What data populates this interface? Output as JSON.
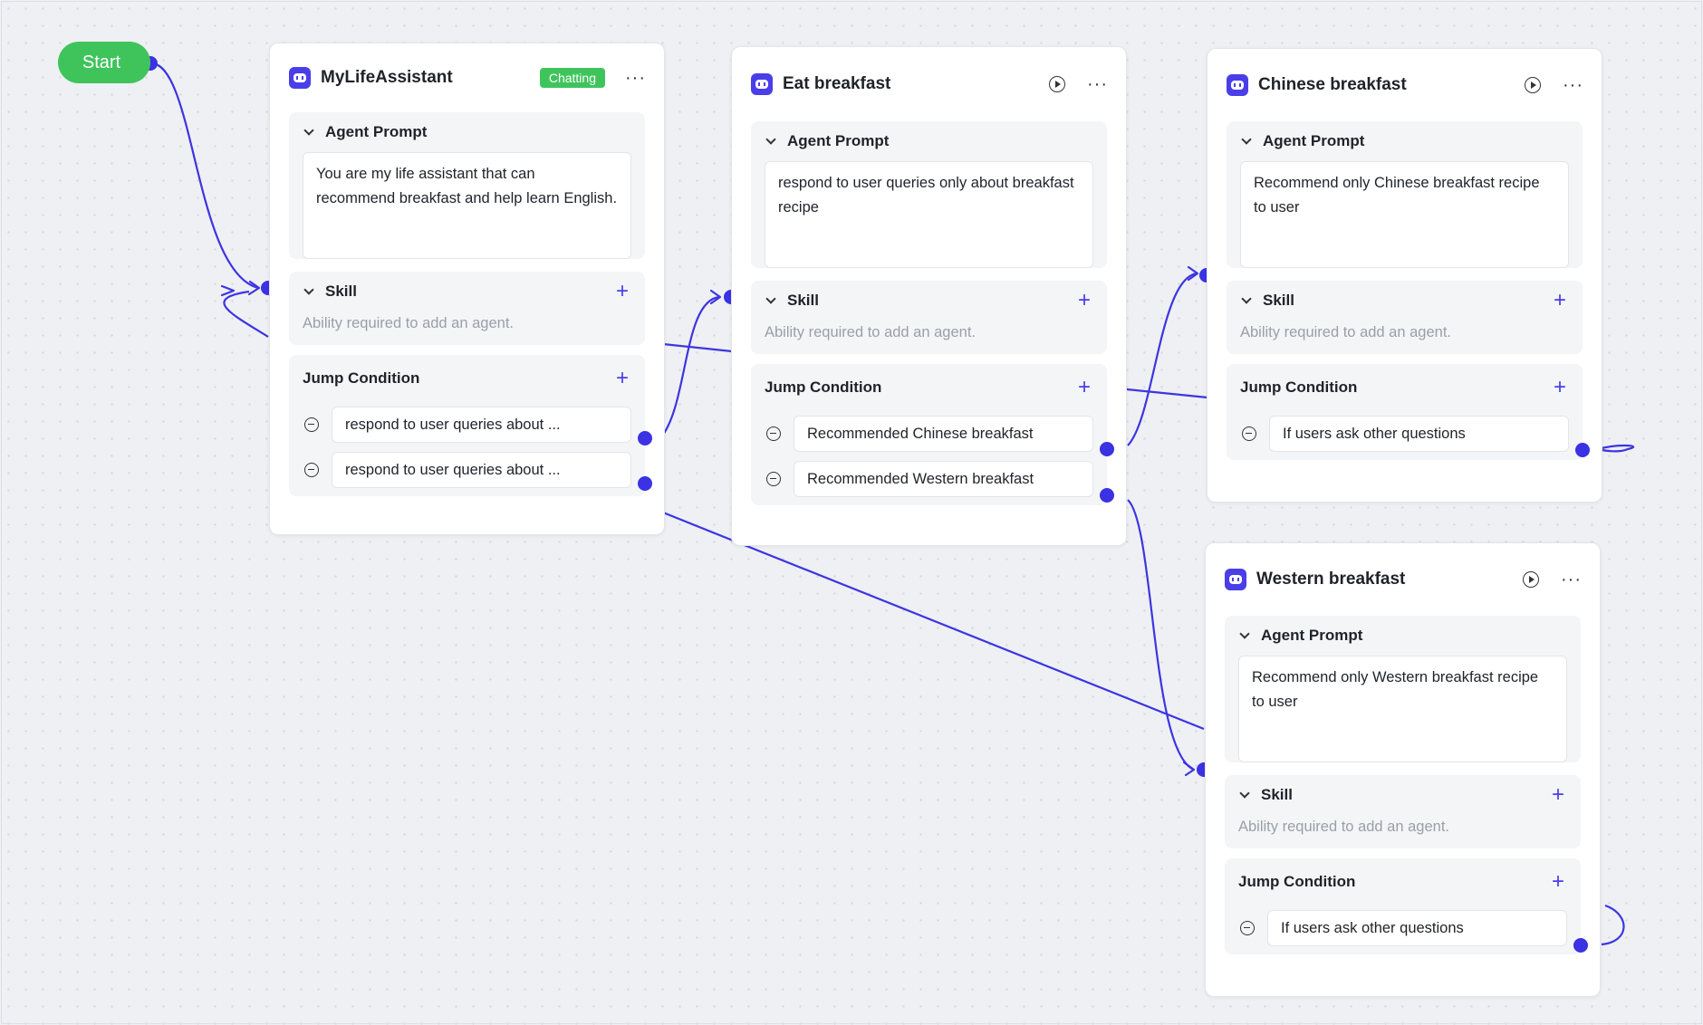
{
  "start": {
    "label": "Start"
  },
  "nodes": [
    {
      "title": "MyLifeAssistant",
      "badge": "Chatting",
      "prompt_label": "Agent Prompt",
      "prompt": "You are my life assistant that can recommend breakfast and help learn English.",
      "skill_label": "Skill",
      "skill_hint": "Ability required to add an agent.",
      "jump_label": "Jump Condition",
      "conditions": [
        "respond to user queries about ...",
        "respond to user queries about ..."
      ]
    },
    {
      "title": "Eat breakfast",
      "prompt_label": "Agent Prompt",
      "prompt": "respond to user queries only about breakfast recipe",
      "skill_label": "Skill",
      "skill_hint": "Ability required to add an agent.",
      "jump_label": "Jump Condition",
      "conditions": [
        "Recommended Chinese breakfast",
        "Recommended Western breakfast"
      ]
    },
    {
      "title": "Chinese breakfast",
      "prompt_label": "Agent Prompt",
      "prompt": "Recommend only Chinese breakfast recipe to user",
      "skill_label": "Skill",
      "skill_hint": "Ability required to add an agent.",
      "jump_label": "Jump Condition",
      "conditions": [
        "If users ask other questions"
      ]
    },
    {
      "title": "Western breakfast",
      "prompt_label": "Agent Prompt",
      "prompt": "Recommend only Western breakfast recipe to user",
      "skill_label": "Skill",
      "skill_hint": "Ability required to add an agent.",
      "jump_label": "Jump Condition",
      "conditions": [
        "If users ask other questions"
      ]
    }
  ],
  "icons": {
    "agent": "bot-icon",
    "run": "play-circle-icon",
    "more": "more-horizontal-icon",
    "collapse": "chevron-down-icon",
    "add": "plus-icon",
    "remove": "minus-circle-icon"
  },
  "colors": {
    "edge": "#3d35e0",
    "start": "#3fc45c",
    "badge": "#3fc45c",
    "agent_icon": "#4a3ee8",
    "canvas": "#eef0f3"
  }
}
